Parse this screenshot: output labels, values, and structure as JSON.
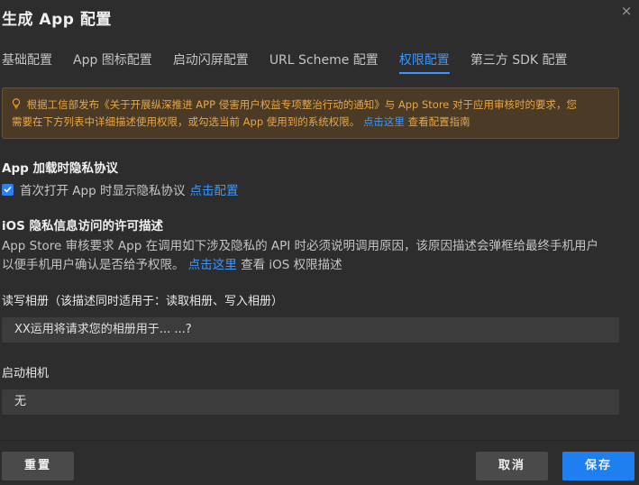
{
  "dialog": {
    "title": "生成 App 配置",
    "close_glyph": "×"
  },
  "tabs": [
    {
      "label": "基础配置"
    },
    {
      "label": "App 图标配置"
    },
    {
      "label": "启动闪屏配置"
    },
    {
      "label": "URL Scheme 配置"
    },
    {
      "label": "权限配置"
    },
    {
      "label": "第三方 SDK 配置"
    }
  ],
  "notice": {
    "icon": "lightbulb-icon",
    "text_line1": "根据工信部发布《关于开展纵深推进 APP 侵害用户权益专项整治行动的通知》与 App Store 对于应用审核时的要求，您",
    "text_line2": "需要在下方列表中详细描述使用权限，或勾选当前 App 使用到的系统权限。",
    "link": "点击这里",
    "text_after_link": "查看配置指南"
  },
  "privacy": {
    "section_title": "App 加载时隐私协议",
    "checkbox_label": "首次打开 App 时显示隐私协议",
    "checkbox_checked": true,
    "config_link": "点击配置"
  },
  "ios_permissions": {
    "section_title": "iOS 隐私信息访问的许可描述",
    "desc_line1": "App Store 审核要求 App 在调用如下涉及隐私的 API 时必须说明调用原因，该原因描述会弹框给最终手机用户",
    "desc_line2_prefix": "以便手机用户确认是否给予权限。",
    "desc_link": "点击这里",
    "desc_line2_suffix": "查看 iOS 权限描述"
  },
  "fields": {
    "photos_label": "读写相册（该描述同时适用于：读取相册、写入相册）",
    "photos_value": "XX运用将请求您的相册用于... ...?",
    "camera_label": "启动相机",
    "camera_value": "无"
  },
  "footer": {
    "reset_label": "重置",
    "cancel_label": "取消",
    "save_label": "保存"
  },
  "colors": {
    "background": "#2d2d2d",
    "accent": "#3c96ff",
    "notice_bg": "#4a3a26",
    "notice_text": "#e8a646",
    "save_button": "#1e7ff0"
  }
}
